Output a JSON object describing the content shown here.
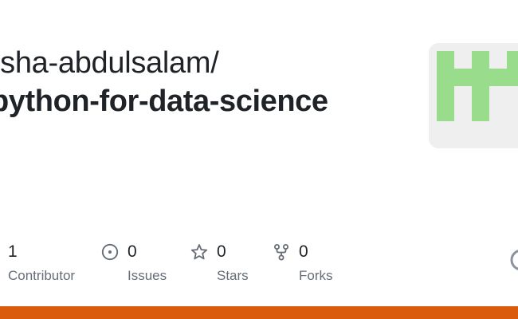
{
  "repo": {
    "owner": "isha-abdulsalam/",
    "name": "python-for-data-science"
  },
  "avatar": {
    "background": "#efefef",
    "pattern_color": "#99dd8c"
  },
  "stats": {
    "contributors": {
      "count": "1",
      "label": "Contributor",
      "icon": "people-icon"
    },
    "issues": {
      "count": "0",
      "label": "Issues",
      "icon": "issue-opened-icon"
    },
    "stars": {
      "count": "0",
      "label": "Stars",
      "icon": "star-icon"
    },
    "forks": {
      "count": "0",
      "label": "Forks",
      "icon": "repo-forked-icon"
    }
  },
  "language_bar": {
    "color": "#da5b0b",
    "share": 1.0
  },
  "colors": {
    "text_primary": "#1f2328",
    "text_secondary": "#656d76",
    "icon": "#656d76"
  }
}
